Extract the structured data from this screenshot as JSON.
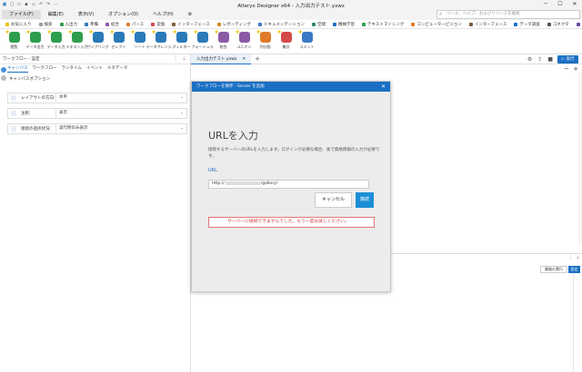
{
  "window": {
    "title": "Alteryx Designer x64 - 入力出力テスト.yxwz",
    "controls": [
      "─",
      "☐",
      "✕"
    ]
  },
  "menu": {
    "items": [
      "ファイル(F)",
      "編集(E)",
      "表示(V)",
      "オプション(O)",
      "ヘルプ(H)"
    ],
    "search_placeholder": "ツール、ヘルプ、およびリソースを検索"
  },
  "categories": [
    {
      "label": "お気に入り",
      "color": "#f0c000"
    },
    {
      "label": "検索",
      "color": "#999999"
    },
    {
      "label": "入出力",
      "color": "#2e9e4e"
    },
    {
      "label": "準備",
      "color": "#2a7ab8"
    },
    {
      "label": "結合",
      "color": "#8b5aa5"
    },
    {
      "label": "パース",
      "color": "#e07b2a"
    },
    {
      "label": "変換",
      "color": "#d44a4a"
    },
    {
      "label": "インターフェース",
      "color": "#7a5a3c"
    },
    {
      "label": "レポーティング",
      "color": "#d08a2a"
    },
    {
      "label": "ドキュメンテーション",
      "color": "#3a7ac4"
    },
    {
      "label": "空間",
      "color": "#2e8a6e"
    },
    {
      "label": "機械学習",
      "color": "#1a6fc4"
    },
    {
      "label": "テキストマイニング",
      "color": "#2e9e4e"
    },
    {
      "label": "コンピュータービジョン",
      "color": "#e07b2a"
    },
    {
      "label": "インターフェース",
      "color": "#7a5a3c"
    },
    {
      "label": "データ調査",
      "color": "#1a6fc4"
    },
    {
      "label": "コネクタ",
      "color": "#555555"
    },
    {
      "label": "住所",
      "color": "#6a4aa5"
    }
  ],
  "tools": [
    {
      "label": "閲覧",
      "color": "#2e9e4e",
      "icon": "browse-icon"
    },
    {
      "label": "データ出力",
      "color": "#2e9e4e",
      "icon": "output-data-icon"
    },
    {
      "label": "データ入力",
      "color": "#2e9e4e",
      "icon": "input-data-icon"
    },
    {
      "label": "テキスト入力",
      "color": "#2e9e4e",
      "icon": "text-input-icon"
    },
    {
      "label": "サンプリング",
      "color": "#2a7ab8",
      "icon": "sample-icon"
    },
    {
      "label": "セレクト",
      "color": "#2a7ab8",
      "icon": "select-icon"
    },
    {
      "label": "ソート",
      "color": "#2a7ab8",
      "icon": "sort-icon"
    },
    {
      "label": "データクレンジ...",
      "color": "#2a7ab8",
      "icon": "cleansing-icon"
    },
    {
      "label": "フィルター",
      "color": "#2a7ab8",
      "icon": "filter-icon"
    },
    {
      "label": "フォーミュラ",
      "color": "#2a7ab8",
      "icon": "formula-icon"
    },
    {
      "label": "結合",
      "color": "#8b5aa5",
      "icon": "join-icon"
    },
    {
      "label": "ユニオン",
      "color": "#8b5aa5",
      "icon": "union-icon"
    },
    {
      "label": "列分割",
      "color": "#e07b2a",
      "icon": "text-to-columns-icon"
    },
    {
      "label": "集計",
      "color": "#d44a4a",
      "icon": "summarize-icon"
    },
    {
      "label": "コメント",
      "color": "#3a7ac4",
      "icon": "comment-icon"
    }
  ],
  "config_panel": {
    "header": "ワークフロー - 設定",
    "tabs": [
      "キャンバス",
      "ワークフロー",
      "ランタイム",
      "イベント",
      "メタデータ"
    ],
    "section": "キャンバスオプション",
    "rows": [
      {
        "label": "レイアウトの方向:",
        "value": "水平"
      },
      {
        "label": "注釈:",
        "value": "表示"
      },
      {
        "label": "接続の進捗状況:",
        "value": "実行時のみ表示"
      }
    ]
  },
  "canvas": {
    "doc_tab": "入力出力テスト.yxwz",
    "doc_tab_close": "✕",
    "run_label": "実行",
    "last_run_label": "最後の実行",
    "settings_label": "設定"
  },
  "modal": {
    "header": "ワークフローを保存 - Server を追加",
    "title": "URLを入力",
    "description": "接続するサーバーのURLを入力します。ログインが必要な場合、後で資格情報の入力が必要です。",
    "url_label": "URL",
    "url_prefix": "http://",
    "url_suffix": "/gallery/",
    "cancel_label": "キャンセル",
    "connect_label": "接続",
    "error_text": "サーバーに接続できませんでした。もう一度お試しください。"
  }
}
